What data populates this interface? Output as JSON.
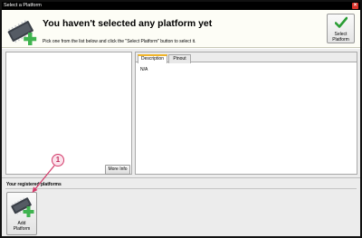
{
  "window": {
    "title": "Select a Platform",
    "close_glyph": "×"
  },
  "header": {
    "title": "You haven't selected any platform yet",
    "subtitle": "Pick one from the list below and click the \"Select Platform\" button to select it.",
    "icon": "board-add-icon",
    "select_button": {
      "line1": "Select",
      "line2": "Platform",
      "icon": "checkmark-icon"
    }
  },
  "left_pane": {
    "more_info_label": "More Info"
  },
  "right_pane": {
    "tabs": [
      {
        "label": "Description",
        "active": true
      },
      {
        "label": "Pinout",
        "active": false
      }
    ],
    "content": "N/A"
  },
  "registered": {
    "title": "Your registered platforms",
    "add_button": {
      "line1": "Add",
      "line2": "Platform",
      "icon": "board-add-icon"
    }
  },
  "annotation": {
    "number": "1"
  },
  "colors": {
    "accent_tab": "#f0b429",
    "check_green": "#2a9d34",
    "plus_green": "#3fb34f",
    "callout": "#d43b6a",
    "close_red": "#d9342b"
  }
}
